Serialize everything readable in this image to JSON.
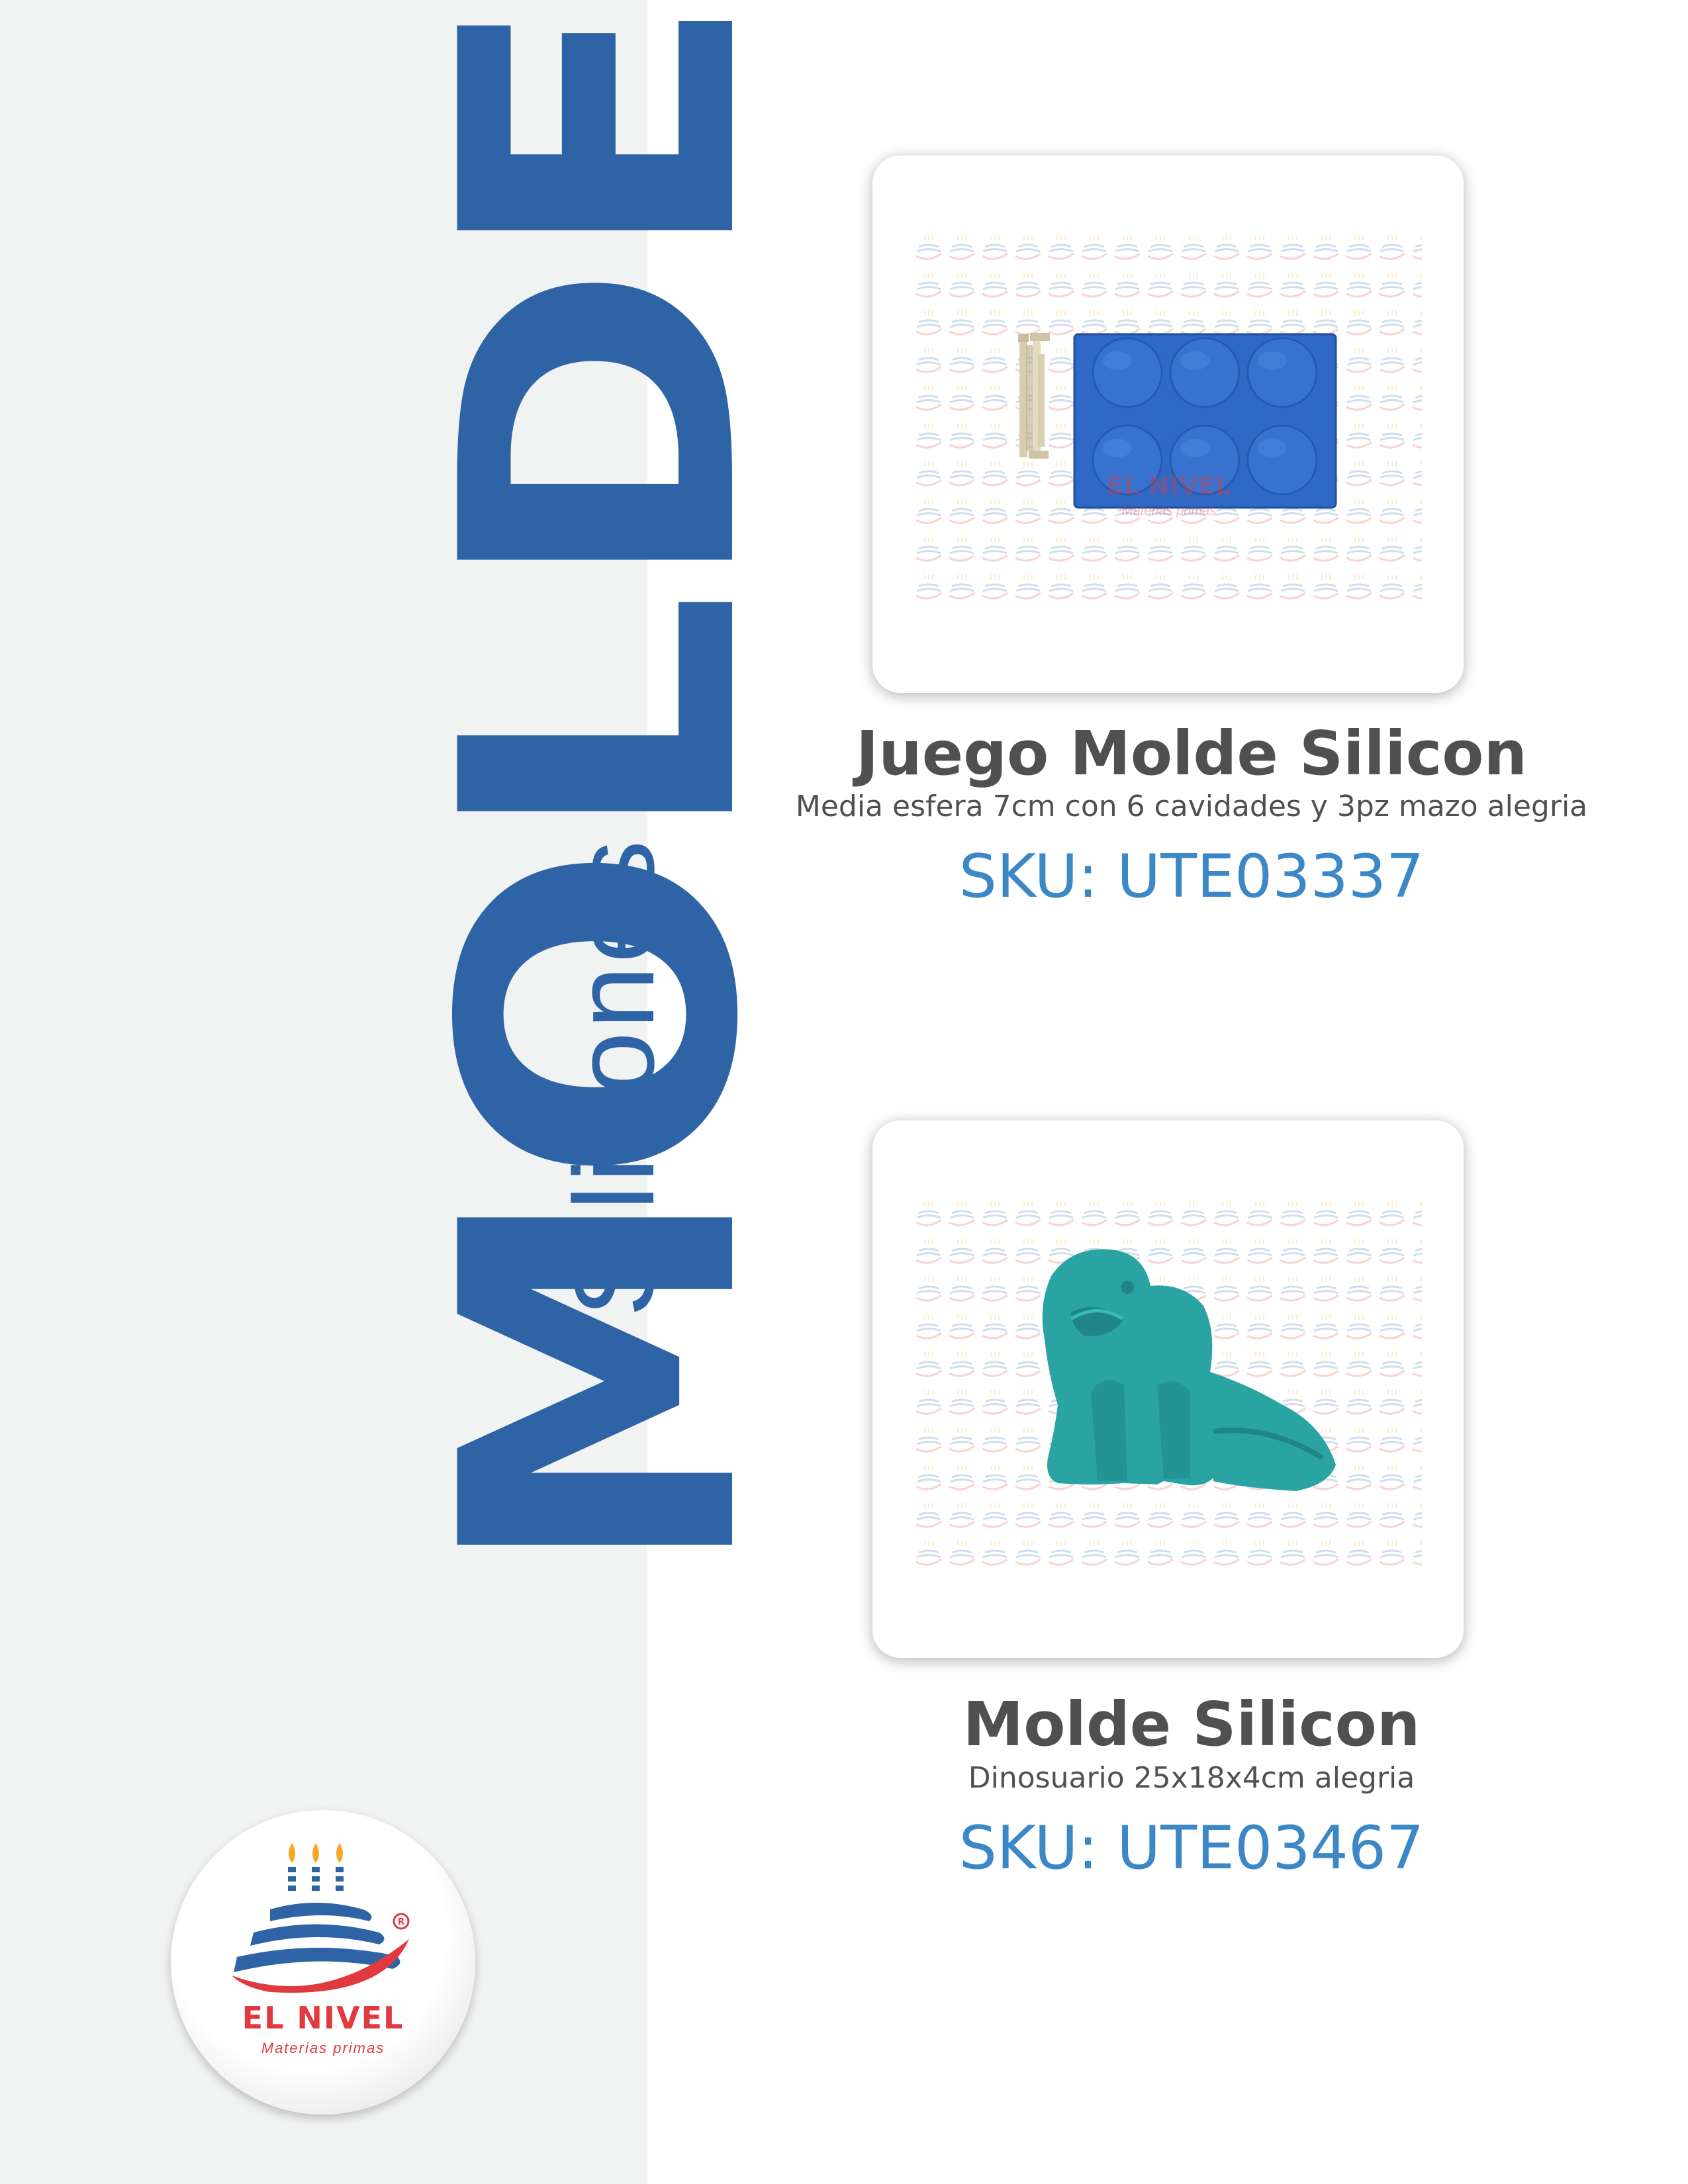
{
  "sidebar": {
    "title": "MOLDES",
    "subtitle": "Silicones",
    "background": "#f1f2f2",
    "accent": "#2e64a6"
  },
  "logo": {
    "name": "EL NIVEL",
    "tagline": "Materias primas",
    "brand_color": "#e03a3e",
    "icon": "birthday-cake-icon"
  },
  "products": [
    {
      "title": "Juego Molde Silicon",
      "description": "Media esfera 7cm con 6 cavidades y 3pz mazo alegria",
      "sku": "SKU: UTE03337",
      "image": "blue-half-sphere-mold-with-mallets",
      "watermark_name": "EL NIVEL",
      "watermark_tagline": "Materias primas"
    },
    {
      "title": "Molde Silicon",
      "description": "Dinosuario 25x18x4cm alegria",
      "sku": "SKU: UTE03467",
      "image": "teal-dinosaur-mold"
    }
  ],
  "colors": {
    "title_text": "#505050",
    "sku_text": "#3c87c6"
  }
}
